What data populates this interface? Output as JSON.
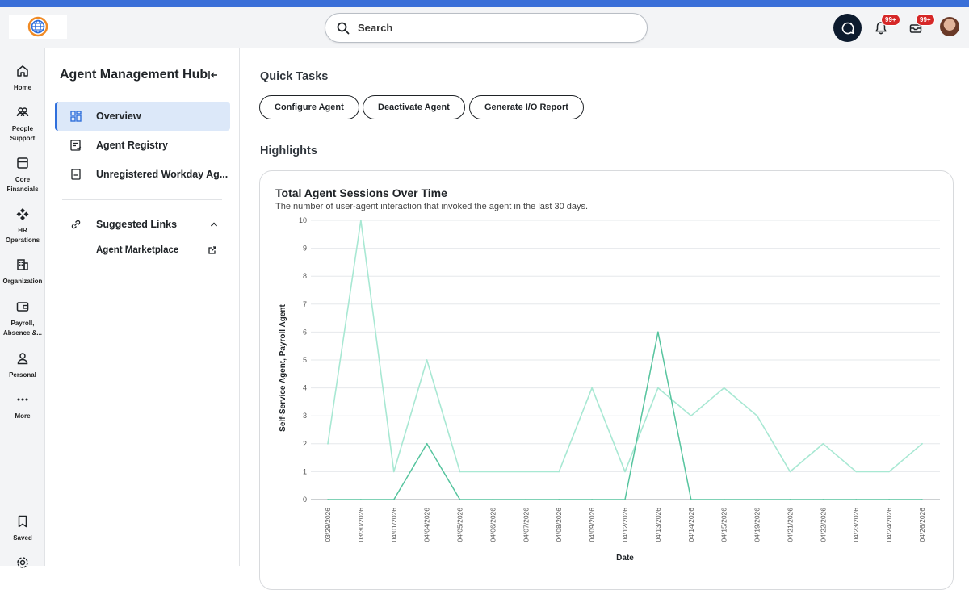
{
  "header": {
    "search_placeholder": "Search",
    "notifications_badge": "99+",
    "inbox_badge": "99+"
  },
  "rail": {
    "items": [
      {
        "label": "Home",
        "icon": "home-icon"
      },
      {
        "label": "People Support",
        "icon": "people-icon"
      },
      {
        "label": "Core Financials",
        "icon": "box-icon"
      },
      {
        "label": "HR Operations",
        "icon": "diamond-grid-icon"
      },
      {
        "label": "Organization",
        "icon": "building-icon"
      },
      {
        "label": "Payroll, Absence &...",
        "icon": "wallet-icon"
      },
      {
        "label": "Personal",
        "icon": "person-icon"
      },
      {
        "label": "More",
        "icon": "more-icon"
      },
      {
        "label": "Saved",
        "icon": "bookmark-icon"
      }
    ]
  },
  "sidenav": {
    "title": "Agent Management Hub",
    "items": [
      {
        "label": "Overview",
        "icon": "grid-icon",
        "active": true
      },
      {
        "label": "Agent Registry",
        "icon": "list-check-icon"
      },
      {
        "label": "Unregistered Workday Ag...",
        "icon": "document-icon"
      }
    ],
    "suggested": {
      "label": "Suggested Links",
      "links": [
        {
          "label": "Agent Marketplace"
        }
      ]
    }
  },
  "main": {
    "quick_tasks_title": "Quick Tasks",
    "quick_tasks": [
      "Configure Agent",
      "Deactivate Agent",
      "Generate I/O Report"
    ],
    "highlights_title": "Highlights"
  },
  "chart_data": {
    "type": "line",
    "title": "Total Agent Sessions Over Time",
    "subtitle": "The number of user-agent interaction that invoked the agent in the last 30 days.",
    "xlabel": "Date",
    "ylabel": "Self-Service Agent, Payroll Agent",
    "ylim": [
      0,
      10
    ],
    "yticks": [
      0,
      1,
      2,
      3,
      4,
      5,
      6,
      7,
      8,
      9,
      10
    ],
    "grid": true,
    "categories": [
      "03/29/2026",
      "03/30/2026",
      "04/01/2026",
      "04/04/2026",
      "04/05/2026",
      "04/06/2026",
      "04/07/2026",
      "04/08/2026",
      "04/09/2026",
      "04/12/2026",
      "04/13/2026",
      "04/14/2026",
      "04/15/2026",
      "04/19/2026",
      "04/21/2026",
      "04/22/2026",
      "04/23/2026",
      "04/24/2026",
      "04/26/2026"
    ],
    "series": [
      {
        "values": [
          2,
          10,
          1,
          5,
          1,
          1,
          1,
          1,
          4,
          1,
          4,
          3,
          4,
          3,
          1,
          2,
          1,
          1,
          2
        ],
        "color": "#a8e8d3"
      },
      {
        "values": [
          0,
          0,
          0,
          2,
          0,
          0,
          0,
          0,
          0,
          0,
          6,
          0,
          0,
          0,
          0,
          0,
          0,
          0,
          0
        ],
        "color": "#56c49e"
      }
    ]
  },
  "colors": {
    "accent": "#2f6fdc",
    "active_nav_bg": "#dce8f9",
    "top_stripe": "#3a6fd8",
    "badge": "#d62828"
  }
}
